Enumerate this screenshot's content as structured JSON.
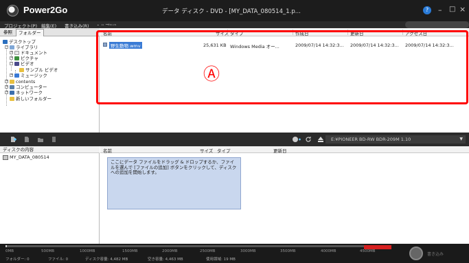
{
  "titlebar": {
    "app_name": "Power2Go",
    "window_title": "データ ディスク - DVD - [MY_DATA_080514_1.p...",
    "help": "?",
    "minimize": "–",
    "maximize": "□",
    "close": "×"
  },
  "menu": {
    "items": [
      "プロジェクト(P)",
      "編集(E)",
      "書き込み(R)",
      "ヘルプ(H)"
    ]
  },
  "tree": {
    "tabs": [
      "参照",
      "フォルダー"
    ],
    "items": [
      "デスクトップ",
      "ライブラリ",
      "ドキュメント",
      "ピクチャ",
      "ビデオ",
      "サンプル ビデオ",
      "ミュージック",
      "contents",
      "コンピューター",
      "ネットワーク",
      "新しいフォルダー"
    ]
  },
  "file_list": {
    "columns": [
      "名前",
      "サイズ",
      "タイプ",
      "作成日",
      "更新日",
      "アクセス日"
    ],
    "rows": [
      {
        "name": "野生動物.wmv",
        "size": "25,631 KB",
        "type": "Windows Media オー...",
        "created": "2009/07/14 14:32:3...",
        "modified": "2009/07/14 14:32:3...",
        "accessed": "2009/07/14 14:32:3..."
      }
    ]
  },
  "annotation": {
    "marker": "Ⓐ",
    "color": "#ff0000"
  },
  "toolbar": {
    "drive": "E:¥PIONEER BD-RW BDR-209M 1.10"
  },
  "disc_pane": {
    "header": "ディスクの内容",
    "item": "MY_DATA_080514"
  },
  "content_pane": {
    "columns": [
      "名前",
      "サイズ",
      "タイプ",
      "更新日"
    ],
    "hint": "ここにデータ ファイルをドラッグ & ドロップするか、ファイルを選んで [ファイルの追加] ボタンをクリックして、ディスクへの追加を開始します。"
  },
  "capacity": {
    "ticks": [
      "0MB",
      "500MB",
      "1000MB",
      "1500MB",
      "2000MB",
      "2500MB",
      "3000MB",
      "3500MB",
      "4000MB",
      "4500MB"
    ],
    "used_mb": 19,
    "max_mb": 4482,
    "status": {
      "folders": "フォルダー: 0",
      "files": "ファイル: 0",
      "capacity": "ディスク容量: 4,482 MB",
      "free": "空き容量: 4,463 MB",
      "used": "使用領域: 19 MB"
    },
    "burn_label": "書き込み"
  }
}
